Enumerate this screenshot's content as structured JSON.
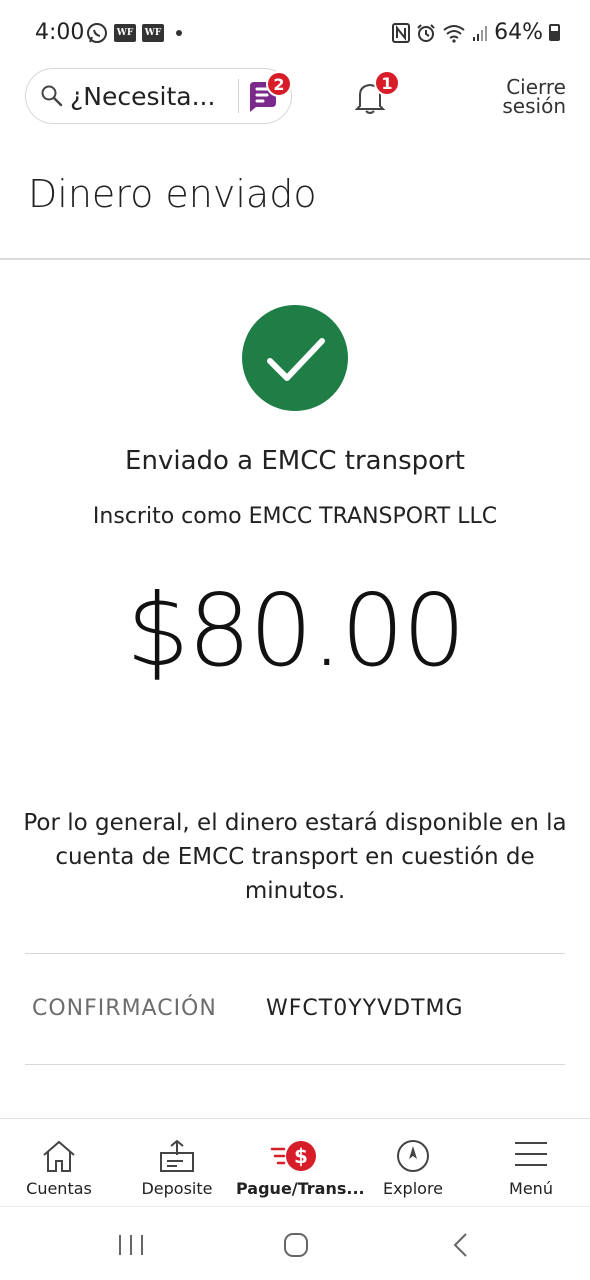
{
  "status_bar": {
    "time": "4:00",
    "wf_labels": [
      "WF",
      "WF"
    ],
    "battery": "64%"
  },
  "header": {
    "search_placeholder": "¿Necesita...",
    "fargo_badge": "2",
    "notifications_badge": "1",
    "logout_line1": "Cierre",
    "logout_line2": "sesión"
  },
  "page": {
    "title": "Dinero enviado"
  },
  "result": {
    "sent_to": "Enviado a EMCC transport",
    "enrolled_as": "Inscrito como EMCC TRANSPORT LLC",
    "amount": "$80.00",
    "info": "Por lo general, el dinero estará disponible en la cuenta de EMCC transport en cuestión de minutos.",
    "confirmation_label": "CONFIRMACIÓN",
    "confirmation_value": "WFCT0YYVDTMG"
  },
  "bottom_nav": {
    "items": [
      {
        "label": "Cuentas",
        "icon": "house-icon"
      },
      {
        "label": "Deposite",
        "icon": "deposit-icon"
      },
      {
        "label": "Pague/Trans...",
        "icon": "pay-transfer-icon"
      },
      {
        "label": "Explore",
        "icon": "compass-icon"
      },
      {
        "label": "Menú",
        "icon": "menu-icon"
      }
    ],
    "active_index": 2
  },
  "colors": {
    "success_green": "#1e7e45",
    "badge_red": "#d71e28",
    "fargo_purple": "#7b2a8c"
  }
}
